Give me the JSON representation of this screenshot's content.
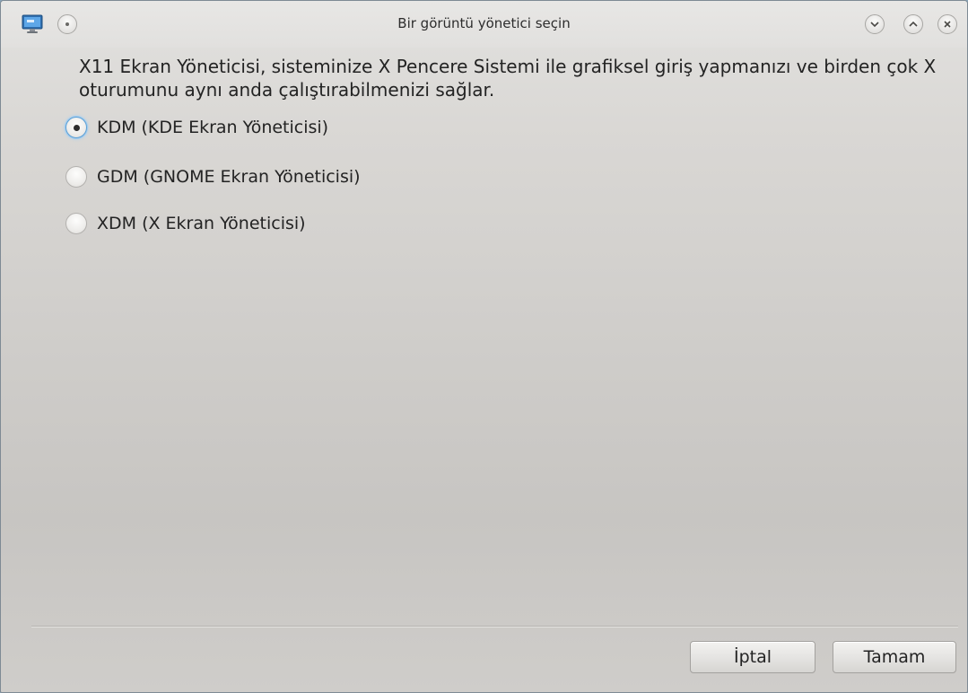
{
  "window": {
    "title": "Bir görüntü yönetici seçin"
  },
  "titlebar_buttons": {
    "sticky_icon": "dot-circle-icon",
    "minimize_icon": "chevron-down-icon",
    "maximize_icon": "chevron-up-icon",
    "close_icon": "close-icon",
    "app_icon": "monitor-icon"
  },
  "dialog": {
    "description": "X11 Ekran Yöneticisi, sisteminize X Pencere Sistemi ile grafiksel giriş yapmanızı ve birden çok X oturumunu aynı anda çalıştırabilmenizi sağlar.",
    "options": [
      {
        "label": "KDM (KDE Ekran Yöneticisi)",
        "checked": true
      },
      {
        "label": "GDM (GNOME Ekran Yöneticisi)",
        "checked": false
      },
      {
        "label": "XDM (X Ekran Yöneticisi)",
        "checked": false
      }
    ]
  },
  "buttons": {
    "cancel_label": "İptal",
    "ok_label": "Tamam"
  },
  "colors": {
    "focus_ring": "#5a9fd6",
    "window_bg": "#cfcdca"
  }
}
